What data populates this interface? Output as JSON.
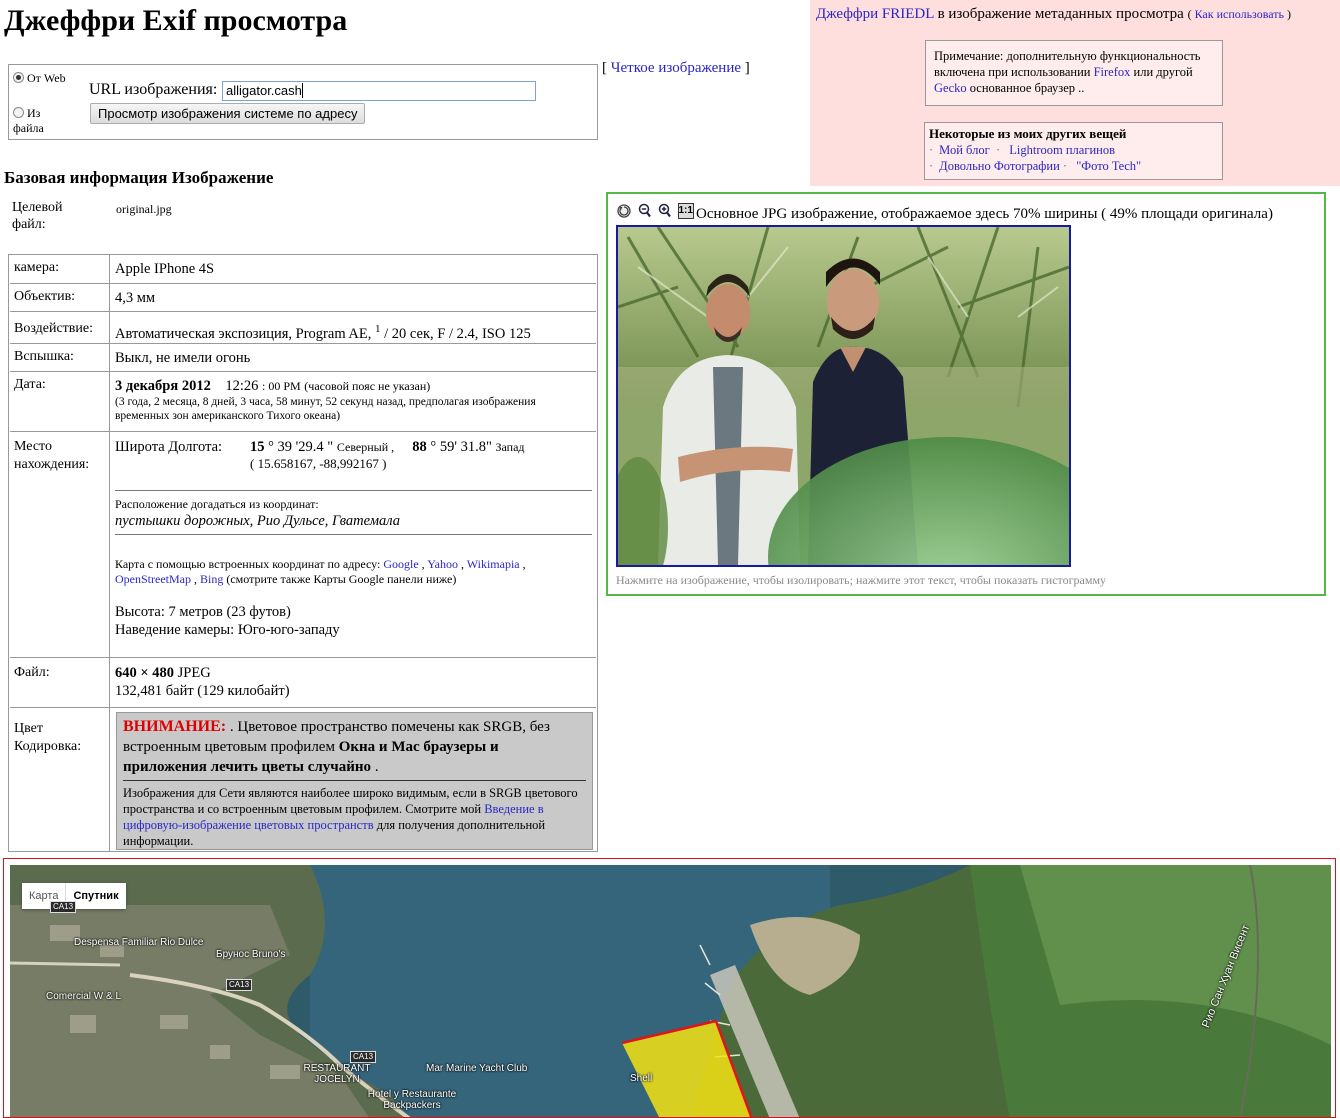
{
  "header": {
    "title": "Джеффри Exif просмотра"
  },
  "form": {
    "radio_web": "От Web",
    "radio_file": "Из файла",
    "url_label": "URL изображения:",
    "url_value": "alligator.cash",
    "view_button": "Просмотр изображения системе по адресу"
  },
  "clear_image": {
    "open": "[",
    "link": "Четкое изображение",
    "close": "]"
  },
  "sidebar": {
    "author_link": "Джеффри FRIEDL",
    "title_rest": "в  изображение метаданных просмотра",
    "howto_link": "Как использовать",
    "note_text_1": "Примечание: дополнительную функциональность включена при использовании",
    "firefox_link": "Firefox",
    "note_text_2": "или другой",
    "gecko_link": "Gecko",
    "note_text_3": "основанное браузер ..",
    "other_title": "Некоторые из моих других вещей",
    "links": [
      "Мой блог",
      "Lightroom плагинов",
      "Довольно Фотографии",
      "\"Фото Tech\""
    ]
  },
  "basic": {
    "heading": "Базовая информация Изображение",
    "target_label": "Целевой файл:",
    "target_value": "original.jpg"
  },
  "rows": {
    "camera": {
      "label": "камера:",
      "value": "Apple IPhone 4S"
    },
    "lens": {
      "label": "Объектив:",
      "value": "4,3 мм"
    },
    "exposure": {
      "label": "Воздействие:",
      "value_pre": "Автоматическая экспозиция, Program AE,",
      "sup": "1",
      "value_post": "/ 20 сек, F / 2.4, ISO 125"
    },
    "flash": {
      "label": "Вспышка:",
      "value": "Выкл, не имели огонь"
    },
    "date": {
      "label": "Дата:",
      "date_bold": "3 декабря 2012",
      "time": "12:26",
      "time_rest": ": 00 PM",
      "tz": "(часовой пояс не указан)",
      "ago": "(3 года, 2 месяца, 8 дней, 3 часа, 58 минут, 52 секунд назад, предполагая изображения временных зон американского Тихого океана)"
    },
    "location": {
      "label": "Место нахождения:",
      "latlon_label": "Широта Долгота:",
      "lat_deg": "15",
      "lat_rest": "° 39 '29.4 \"",
      "lat_dir": "Северный ,",
      "lon_deg": "88",
      "lon_rest": "° 59' 31.8\"",
      "lon_dir": "Запад",
      "decimal": "( 15.658167, -88,992167 )",
      "guess_label": "Расположение догадаться из координат:",
      "guess_value": "пустышки дорожных, Рио Дульсе, Гватемала",
      "map_text": "Карта с помощью встроенных координат по адресу:",
      "map_links": [
        "Google",
        "Yahoo",
        "Wikimapia",
        "OpenStreetMap",
        "Bing"
      ],
      "map_note": "(смотрите также Карты Google панели ниже)",
      "altitude": "Высота: 7 метров (23 футов)",
      "direction": "Наведение камеры: Юго-юго-западу"
    },
    "file": {
      "label": "Файл:",
      "dims": "640 × 480",
      "type": "JPEG",
      "size": "132,481 байт (129 килобайт)"
    },
    "color": {
      "label": "Цвет Кодировка:",
      "warn": "ВНИМАНИЕ:",
      "main_1": ". Цветовое пространство помечены как SRGB, без встроенным цветовым профилем",
      "main_bold": "Окна и Mac браузеры и приложения лечить цветы случайно",
      "main_end": ".",
      "sub_1": "Изображения для Сети являются наиболее широко видимым, если в SRGB цветового пространства и со встроенным цветовым профилем. Смотрите мой",
      "sub_link": "Введение в цифровую-изображение цветовых пространств",
      "sub_2": "для получения дополнительной информации."
    }
  },
  "image_panel": {
    "one_to_one": "1:1",
    "caption": "Основное JPG изображение, отображаемое здесь 70% ширины ( 49% площади оригинала)",
    "histogram_text": "Нажмите на изображение, чтобы изолировать; нажмите этот текст, чтобы показать гистограмму"
  },
  "map": {
    "type_map": "Карта",
    "type_satellite": "Спутник",
    "labels": [
      "Despensa Familiar Rio Dulce",
      "Брунос Bruno's",
      "Comercial W & L",
      "RESTAURANT JOCELYN",
      "Mar Marine Yacht Club",
      "Hotel y Restaurante Backpackers",
      "Shell",
      "Рио Сан Хуан Висент"
    ],
    "roads": [
      "CA13",
      "CA13",
      "CA13"
    ]
  },
  "colors": {
    "pink_panel": "#ffdede",
    "image_border": "#55b845",
    "map_border": "#dd1111",
    "warning": "#e00000",
    "link": "#2a27c7"
  }
}
